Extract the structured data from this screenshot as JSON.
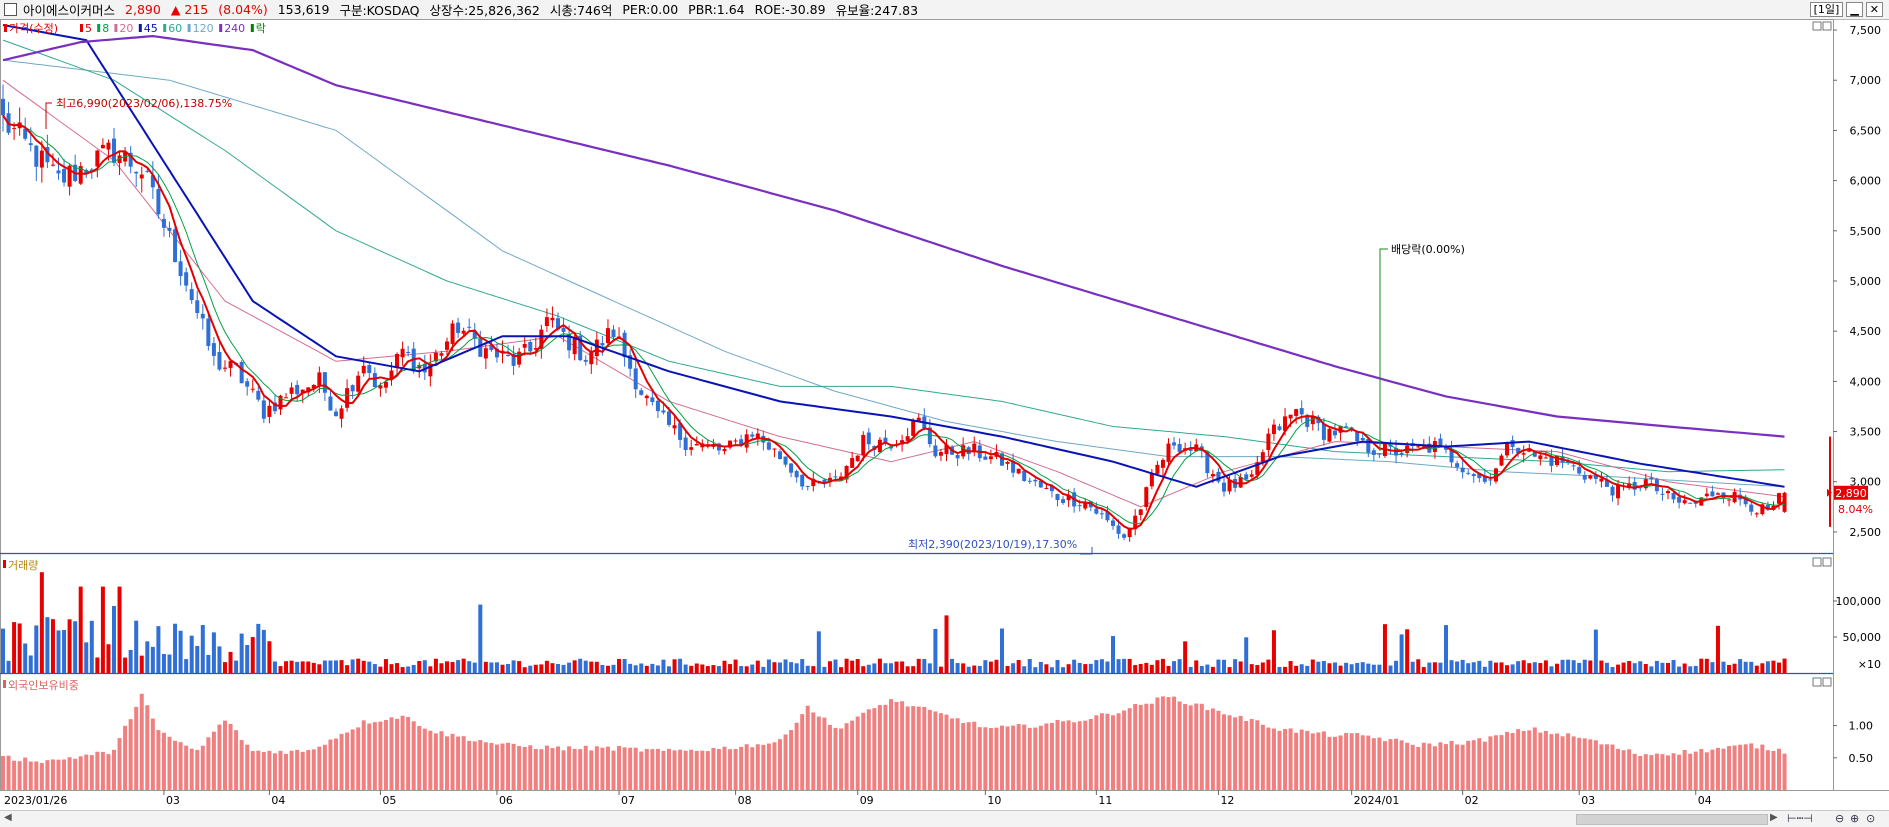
{
  "header": {
    "name": "아이에스이커머스",
    "price": "2,890",
    "change": "▲ 215",
    "change_pct": "(8.04%)",
    "volume": "153,619",
    "market": "구분:KOSDAQ",
    "shares": "상장수:25,826,362",
    "mcap": "시총:746억",
    "per": "PER:0.00",
    "pbr": "PBR:1.64",
    "roe": "ROE:-30.89",
    "retention": "유보율:247.83",
    "period_button": "[1일]"
  },
  "colors": {
    "up": "#e60000",
    "down": "#2f6fd6",
    "ma5": "#e30000",
    "ma8": "#00a046",
    "ma20": "#d36d92",
    "ma45": "#0a14b4",
    "ma60": "#30a890",
    "ma120": "#6fa8c8",
    "ma240": "#7a2fc0",
    "foreign": "#f08080"
  },
  "chart_data": [
    {
      "type": "candlestick",
      "title": "가격(수정)",
      "legend": [
        {
          "label": "가격(수정)",
          "color": "#e60000"
        },
        {
          "label": "5",
          "color": "#e30000"
        },
        {
          "label": "8",
          "color": "#00a046"
        },
        {
          "label": "20",
          "color": "#d36d92"
        },
        {
          "label": "45",
          "color": "#0a14b4"
        },
        {
          "label": "60",
          "color": "#30a890"
        },
        {
          "label": "120",
          "color": "#6fa8c8"
        },
        {
          "label": "240",
          "color": "#7a2fc0"
        },
        {
          "label": "락",
          "color": "#008000"
        }
      ],
      "x_labels": [
        "2023/01/26",
        "03",
        "04",
        "05",
        "06",
        "07",
        "08",
        "09",
        "10",
        "11",
        "12",
        "2024/01",
        "02",
        "03",
        "04"
      ],
      "y_ticks": [
        "7,500",
        "7,000",
        "6,500",
        "6,000",
        "5,500",
        "5,000",
        "4,500",
        "4,000",
        "3,500",
        "3,000",
        "2,500"
      ],
      "ylim": [
        2290,
        7610
      ],
      "last_price_label": "2,890",
      "last_change_label": "8.04%",
      "close_anchors": [
        [
          0,
          6600
        ],
        [
          10,
          6000
        ],
        [
          20,
          6300
        ],
        [
          25,
          6100
        ],
        [
          33,
          5000
        ],
        [
          38,
          4200
        ],
        [
          42,
          4100
        ],
        [
          47,
          3700
        ],
        [
          52,
          3900
        ],
        [
          57,
          4000
        ],
        [
          60,
          3700
        ],
        [
          65,
          4200
        ],
        [
          68,
          3900
        ],
        [
          72,
          4300
        ],
        [
          76,
          4100
        ],
        [
          82,
          4550
        ],
        [
          87,
          4300
        ],
        [
          92,
          4200
        ],
        [
          95,
          4300
        ],
        [
          98,
          4600
        ],
        [
          105,
          4250
        ],
        [
          110,
          4500
        ],
        [
          115,
          3900
        ],
        [
          118,
          3650
        ],
        [
          123,
          3400
        ],
        [
          130,
          3300
        ],
        [
          135,
          3500
        ],
        [
          140,
          3250
        ],
        [
          145,
          2950
        ],
        [
          150,
          3000
        ],
        [
          155,
          3400
        ],
        [
          160,
          3400
        ],
        [
          165,
          3600
        ],
        [
          168,
          3300
        ],
        [
          175,
          3300
        ],
        [
          180,
          3200
        ],
        [
          185,
          3000
        ],
        [
          190,
          2850
        ],
        [
          195,
          2800
        ],
        [
          199,
          2600
        ],
        [
          202,
          2450
        ],
        [
          205,
          2750
        ],
        [
          208,
          3150
        ],
        [
          211,
          3400
        ],
        [
          215,
          3300
        ],
        [
          220,
          2950
        ],
        [
          225,
          3000
        ],
        [
          228,
          3450
        ],
        [
          233,
          3700
        ],
        [
          238,
          3500
        ],
        [
          242,
          3500
        ],
        [
          245,
          3350
        ],
        [
          250,
          3300
        ],
        [
          253,
          3300
        ],
        [
          258,
          3350
        ],
        [
          262,
          3200
        ],
        [
          267,
          3000
        ],
        [
          272,
          3400
        ],
        [
          276,
          3250
        ],
        [
          281,
          3200
        ],
        [
          286,
          3050
        ],
        [
          291,
          2900
        ],
        [
          296,
          3000
        ],
        [
          301,
          2800
        ],
        [
          305,
          2780
        ],
        [
          309,
          2920
        ],
        [
          314,
          2800
        ],
        [
          318,
          2680
        ],
        [
          321,
          2890
        ]
      ],
      "ma_anchors": {
        "ma20": [
          [
            0,
            7000
          ],
          [
            20,
            6200
          ],
          [
            40,
            4800
          ],
          [
            60,
            4200
          ],
          [
            80,
            4300
          ],
          [
            100,
            4450
          ],
          [
            120,
            3800
          ],
          [
            140,
            3450
          ],
          [
            160,
            3200
          ],
          [
            175,
            3400
          ],
          [
            190,
            3100
          ],
          [
            205,
            2750
          ],
          [
            220,
            3100
          ],
          [
            240,
            3400
          ],
          [
            260,
            3350
          ],
          [
            280,
            3300
          ],
          [
            300,
            3000
          ],
          [
            321,
            2850
          ]
        ],
        "ma45": [
          [
            0,
            7550
          ],
          [
            15,
            7400
          ],
          [
            30,
            6100
          ],
          [
            45,
            4800
          ],
          [
            60,
            4250
          ],
          [
            75,
            4100
          ],
          [
            90,
            4450
          ],
          [
            102,
            4450
          ],
          [
            120,
            4100
          ],
          [
            140,
            3800
          ],
          [
            160,
            3650
          ],
          [
            180,
            3450
          ],
          [
            200,
            3200
          ],
          [
            215,
            2950
          ],
          [
            230,
            3250
          ],
          [
            245,
            3400
          ],
          [
            260,
            3350
          ],
          [
            275,
            3400
          ],
          [
            295,
            3180
          ],
          [
            321,
            2950
          ]
        ],
        "ma60": [
          [
            0,
            7400
          ],
          [
            20,
            7000
          ],
          [
            40,
            6300
          ],
          [
            60,
            5500
          ],
          [
            80,
            5000
          ],
          [
            100,
            4650
          ],
          [
            120,
            4200
          ],
          [
            140,
            3950
          ],
          [
            160,
            3950
          ],
          [
            180,
            3800
          ],
          [
            200,
            3550
          ],
          [
            220,
            3450
          ],
          [
            240,
            3300
          ],
          [
            260,
            3250
          ],
          [
            280,
            3200
          ],
          [
            300,
            3100
          ],
          [
            321,
            3120
          ]
        ],
        "ma120": [
          [
            0,
            7200
          ],
          [
            30,
            7000
          ],
          [
            60,
            6500
          ],
          [
            90,
            5300
          ],
          [
            110,
            4800
          ],
          [
            130,
            4300
          ],
          [
            150,
            3900
          ],
          [
            170,
            3600
          ],
          [
            190,
            3400
          ],
          [
            210,
            3250
          ],
          [
            230,
            3250
          ],
          [
            250,
            3200
          ],
          [
            270,
            3100
          ],
          [
            290,
            3050
          ],
          [
            321,
            2950
          ]
        ],
        "ma240": [
          [
            0,
            7200
          ],
          [
            14,
            7380
          ],
          [
            27,
            7440
          ],
          [
            45,
            7300
          ],
          [
            60,
            6950
          ],
          [
            90,
            6550
          ],
          [
            120,
            6150
          ],
          [
            150,
            5700
          ],
          [
            180,
            5150
          ],
          [
            210,
            4650
          ],
          [
            240,
            4150
          ],
          [
            260,
            3850
          ],
          [
            280,
            3650
          ],
          [
            300,
            3550
          ],
          [
            321,
            3450
          ]
        ]
      },
      "annotations": [
        {
          "text": "최고6,990(2023/02/06),138.75%"
        },
        {
          "text": "최저2,390(2023/10/19),17.30%"
        },
        {
          "text": "배당락(0.00%)"
        }
      ]
    },
    {
      "type": "bar",
      "title": "거래량",
      "y_ticks": [
        "100,000",
        "50,000"
      ],
      "unit": "×10",
      "ylim": [
        0,
        150000
      ]
    },
    {
      "type": "bar",
      "title": "외국인보유비중",
      "y_ticks": [
        "1.00",
        "0.50"
      ],
      "ylim": [
        0,
        1.6
      ],
      "anchors": [
        [
          0,
          0.5
        ],
        [
          8,
          0.45
        ],
        [
          20,
          0.6
        ],
        [
          25,
          1.5
        ],
        [
          28,
          0.9
        ],
        [
          35,
          0.6
        ],
        [
          40,
          1.1
        ],
        [
          45,
          0.6
        ],
        [
          55,
          0.6
        ],
        [
          65,
          1.05
        ],
        [
          72,
          1.15
        ],
        [
          78,
          0.9
        ],
        [
          90,
          0.7
        ],
        [
          100,
          0.65
        ],
        [
          110,
          0.65
        ],
        [
          120,
          0.6
        ],
        [
          130,
          0.65
        ],
        [
          140,
          0.75
        ],
        [
          145,
          1.3
        ],
        [
          150,
          0.95
        ],
        [
          160,
          1.4
        ],
        [
          170,
          1.15
        ],
        [
          178,
          0.95
        ],
        [
          185,
          1.0
        ],
        [
          195,
          1.1
        ],
        [
          200,
          1.2
        ],
        [
          210,
          1.45
        ],
        [
          220,
          1.2
        ],
        [
          230,
          0.95
        ],
        [
          240,
          0.85
        ],
        [
          245,
          0.85
        ],
        [
          255,
          0.7
        ],
        [
          265,
          0.75
        ],
        [
          275,
          0.95
        ],
        [
          285,
          0.8
        ],
        [
          295,
          0.55
        ],
        [
          305,
          0.6
        ],
        [
          315,
          0.7
        ],
        [
          321,
          0.6
        ]
      ]
    }
  ]
}
